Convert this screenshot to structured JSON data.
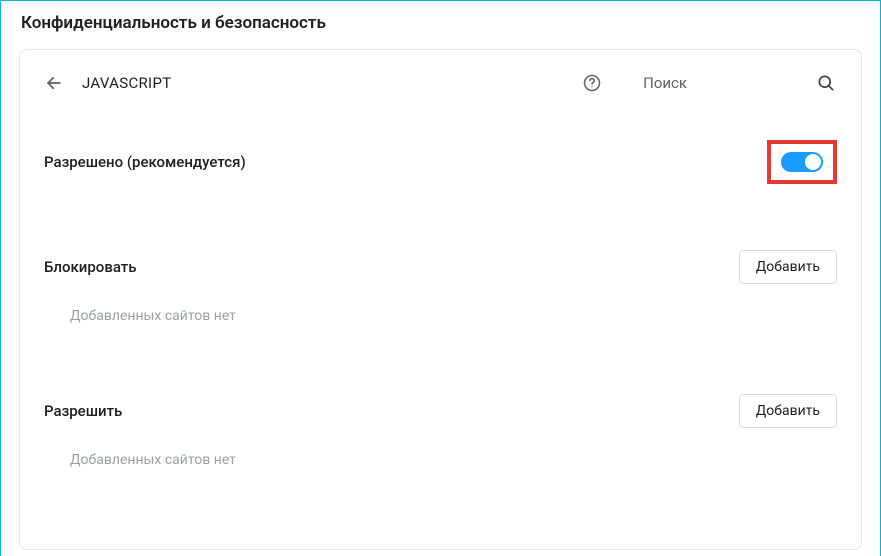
{
  "page": {
    "title": "Конфиденциальность и безопасность"
  },
  "header": {
    "title": "JAVASCRIPT",
    "search_label": "Поиск"
  },
  "main_setting": {
    "label": "Разрешено (рекомендуется)",
    "toggle_on": true
  },
  "sections": {
    "block": {
      "title": "Блокировать",
      "add_label": "Добавить",
      "empty_text": "Добавленных сайтов нет"
    },
    "allow": {
      "title": "Разрешить",
      "add_label": "Добавить",
      "empty_text": "Добавленных сайтов нет"
    }
  },
  "colors": {
    "highlight_border": "#e53935",
    "toggle_active": "#1a9cff"
  }
}
